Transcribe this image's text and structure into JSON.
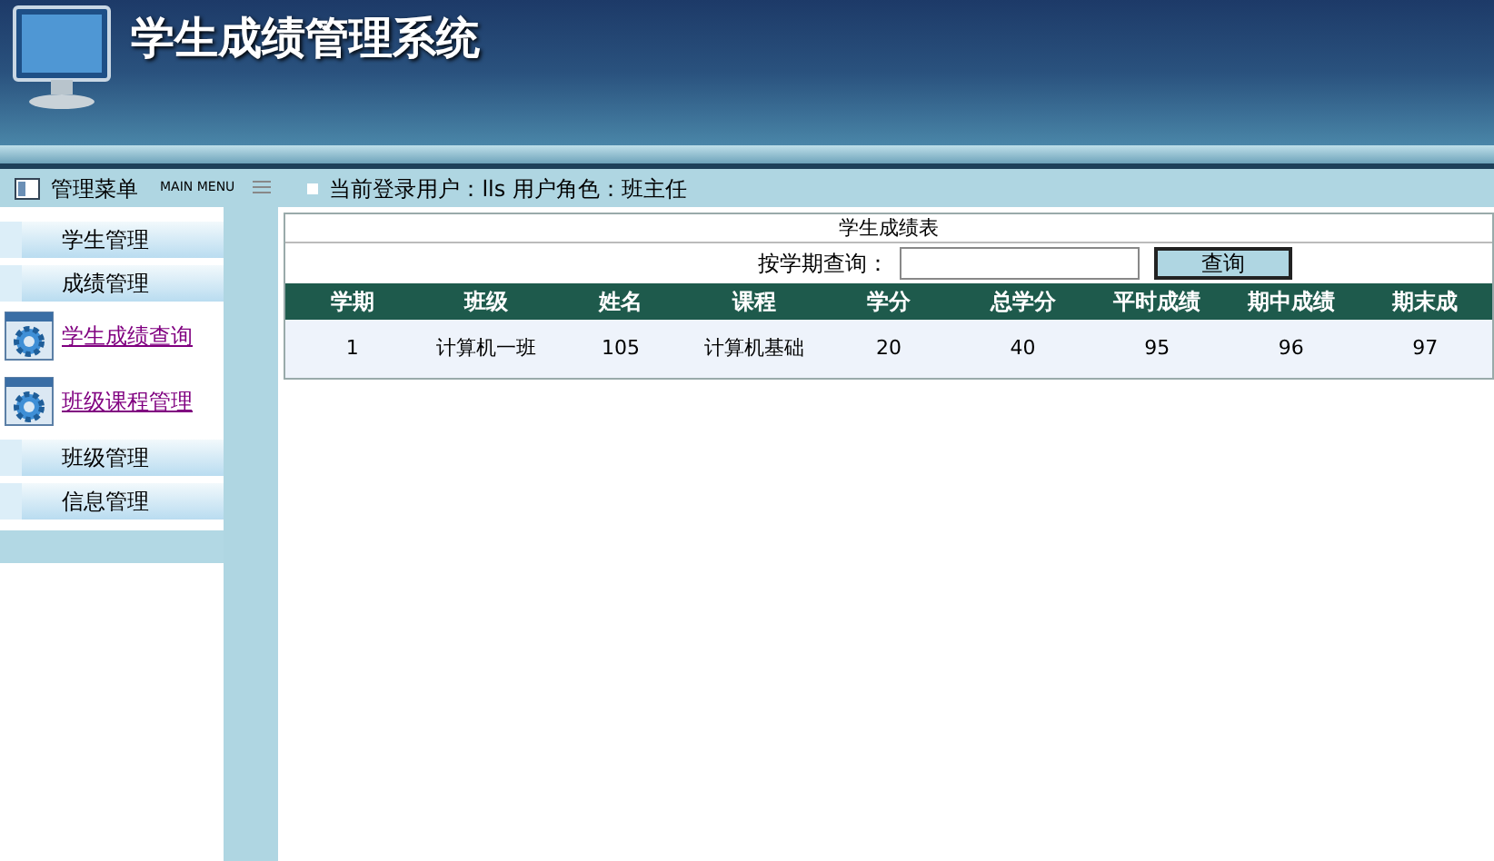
{
  "header": {
    "title": "学生成绩管理系统"
  },
  "menu_bar": {
    "title": "管理菜单",
    "subtitle": "MAIN MENU",
    "user_text": "当前登录用户：lls 用户角色：班主任"
  },
  "sidebar": {
    "items": [
      {
        "kind": "section",
        "label": "学生管理"
      },
      {
        "kind": "section",
        "label": "成绩管理"
      },
      {
        "kind": "link",
        "label": "学生成绩查询"
      },
      {
        "kind": "link",
        "label": "班级课程管理"
      },
      {
        "kind": "section",
        "label": "班级管理"
      },
      {
        "kind": "section",
        "label": "信息管理"
      }
    ]
  },
  "content": {
    "title": "学生成绩表",
    "search": {
      "label": "按学期查询：",
      "button": "查询"
    },
    "table": {
      "columns": [
        "学期",
        "班级",
        "姓名",
        "课程",
        "学分",
        "总学分",
        "平时成绩",
        "期中成绩",
        "期末成"
      ],
      "rows": [
        [
          "1",
          "计算机一班",
          "105",
          "计算机基础",
          "20",
          "40",
          "95",
          "96",
          "97"
        ]
      ]
    }
  }
}
